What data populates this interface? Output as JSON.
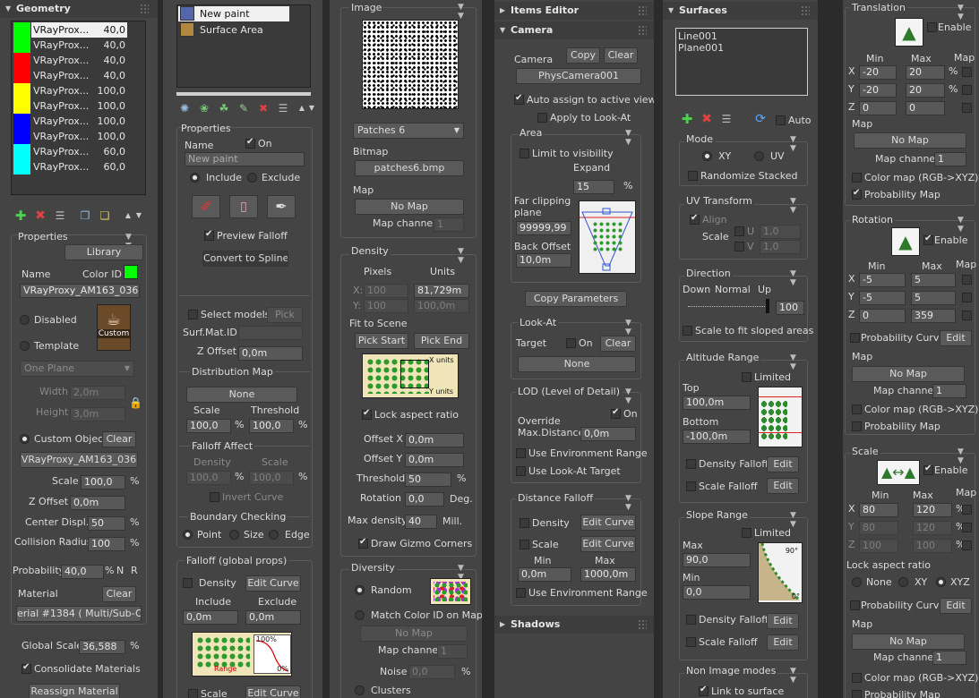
{
  "geometry": {
    "title": "Geometry",
    "items": [
      {
        "name": "VRayProx...",
        "value": "40,0",
        "color": "#00ff00"
      },
      {
        "name": "VRayProx...",
        "value": "40,0",
        "color": "#00ff00"
      },
      {
        "name": "VRayProx...",
        "value": "40,0",
        "color": "#ff0000"
      },
      {
        "name": "VRayProx...",
        "value": "40,0",
        "color": "#ff0000"
      },
      {
        "name": "VRayProx...",
        "value": "100,0",
        "color": "#ffff00"
      },
      {
        "name": "VRayProx...",
        "value": "100,0",
        "color": "#ffff00"
      },
      {
        "name": "VRayProx...",
        "value": "100,0",
        "color": "#0000ff"
      },
      {
        "name": "VRayProx...",
        "value": "100,0",
        "color": "#0000ff"
      },
      {
        "name": "VRayProx...",
        "value": "60,0",
        "color": "#00ffff"
      },
      {
        "name": "VRayProx...",
        "value": "60,0",
        "color": "#00ffff"
      }
    ],
    "properties": "Properties",
    "library": "Library",
    "name_label": "Name",
    "color_id_label": "Color ID",
    "name_value": "VRayProxy_AM163_036",
    "disabled": "Disabled",
    "template": "Template",
    "custom_thumb": "Custom",
    "one_plane": "One Plane",
    "width_label": "Width",
    "width_value": "2,0m",
    "height_label": "Height",
    "height_value": "3,0m",
    "custom_object": "Custom Object",
    "clear": "Clear",
    "custom_object_value": "VRayProxy_AM163_036",
    "scale_label": "Scale",
    "scale_value": "100,0",
    "pct": "%",
    "zoffset_label": "Z Offset",
    "zoffset_value": "0,0m",
    "center_label": "Center Displ.",
    "center_value": "50",
    "collision_label": "Collision Radius",
    "collision_value": "100",
    "probability_label": "Probability",
    "probability_value": "40,0",
    "n": "N",
    "r": "R",
    "material_label": "Material",
    "material_value": "erial #1384  ( Multi/Sub-Obje",
    "global_scale_label": "Global Scale",
    "global_scale_value": "36,588",
    "consolidate": "Consolidate Materials",
    "reassign": "Reassign Material"
  },
  "paint": {
    "items": [
      {
        "name": "New paint"
      },
      {
        "name": "Surface Area"
      }
    ],
    "properties": "Properties",
    "name_label": "Name",
    "on": "On",
    "name_value": "New paint",
    "include": "Include",
    "exclude": "Exclude",
    "preview_falloff": "Preview Falloff",
    "convert": "Convert to Spline",
    "select_models": "Select models",
    "pick": "Pick",
    "surf_mat": "Surf.Mat.ID",
    "zoffset_label": "Z Offset",
    "zoffset_value": "0,0m",
    "dist_map": "Distribution Map",
    "none": "None",
    "scale_label": "Scale",
    "threshold_label": "Threshold",
    "scale_value": "100,0",
    "threshold_value": "100,0",
    "pct": "%",
    "falloff_affect": "Falloff Affect",
    "density_label": "Density",
    "density_value": "100,0",
    "fa_scale_value": "100,0",
    "invert_curve": "Invert Curve",
    "boundary": "Boundary Checking",
    "point": "Point",
    "size": "Size",
    "edge": "Edge",
    "falloff_global": "Falloff (global props)",
    "edit_curve": "Edit Curve",
    "exclude_label": "Exclude",
    "include_value": "0,0m",
    "exclude_value": "0,0m",
    "range": "Range",
    "pct100": "100%",
    "pct0": "0%",
    "scale2": "Scale"
  },
  "image": {
    "title": "Image",
    "patches": "Patches 6",
    "bitmap_label": "Bitmap",
    "bitmap_value": "patches6.bmp",
    "map_label": "Map",
    "no_map": "No Map",
    "map_channel": "Map channel",
    "map_channel_value": "1",
    "density_title": "Density",
    "pixels": "Pixels",
    "units": "Units",
    "x": "X:",
    "y": "Y:",
    "px_x": "100",
    "px_y": "100",
    "u_x": "81,729m",
    "u_y": "100,0m",
    "fit_scene": "Fit to Scene",
    "pick_start": "Pick Start",
    "pick_end": "Pick End",
    "x_units": "X units",
    "y_units": "Y units",
    "lock_aspect": "Lock aspect ratio",
    "offset_x_label": "Offset X",
    "offset_x": "0,0m",
    "offset_y_label": "Offset Y",
    "offset_y": "0,0m",
    "threshold_label": "Threshold",
    "threshold": "50",
    "pct": "%",
    "rotation_label": "Rotation",
    "rotation": "0,0",
    "deg": "Deg.",
    "max_density_label": "Max density",
    "max_density": "40",
    "mill": "Mill.",
    "draw_gizmo": "Draw Gizmo Corners",
    "diversity": "Diversity",
    "random": "Random",
    "match_color": "Match Color ID on Map",
    "no_map2": "No Map",
    "map_channel2": "Map channel",
    "map_channel2_value": "1",
    "noise_label": "Noise",
    "noise": "0,0",
    "clusters": "Clusters"
  },
  "items": {
    "title": "Items Editor",
    "camera_title": "Camera",
    "camera_label": "Camera",
    "copy": "Copy",
    "clear": "Clear",
    "camera_value": "PhysCamera001",
    "auto_assign": "Auto assign to active view",
    "apply_look": "Apply to Look-At",
    "area": "Area",
    "limit_vis": "Limit to visibility",
    "expand": "Expand",
    "expand_value": "15",
    "pct": "%",
    "far_clip": "Far clipping",
    "plane": "plane",
    "far_value": "99999,99",
    "back_offset": "Back Offset",
    "back_value": "10,0m",
    "copy_params": "Copy Parameters",
    "look_at": "Look-At",
    "target": "Target",
    "on": "On",
    "none": "None",
    "lod": "LOD (Level of Detail)",
    "override": "Override",
    "max_dist": "Max.Distance",
    "max_dist_value": "0,0m",
    "use_env": "Use Environment Range",
    "use_look": "Use Look-At Target",
    "dist_falloff": "Distance Falloff",
    "density": "Density",
    "edit_curve": "Edit Curve",
    "scale": "Scale",
    "min": "Min",
    "max": "Max",
    "min_value": "0,0m",
    "max_value": "1000,0m",
    "use_env2": "Use Environment Range",
    "shadows": "Shadows"
  },
  "surfaces": {
    "title": "Surfaces",
    "list": [
      "Line001",
      "Plane001"
    ],
    "auto": "Auto",
    "mode": "Mode",
    "xy": "XY",
    "uv": "UV",
    "randomize": "Randomize Stacked",
    "uv_transform": "UV Transform",
    "align": "Align",
    "scale": "Scale",
    "u": "U",
    "v": "V",
    "u_value": "1,0",
    "v_value": "1,0",
    "direction": "Direction",
    "down": "Down",
    "normal": "Normal",
    "up": "Up",
    "dir_value": "100",
    "scale_fit": "Scale to fit sloped areas",
    "altitude": "Altitude Range",
    "limited": "Limited",
    "top": "Top",
    "top_value": "100,0m",
    "bottom": "Bottom",
    "bottom_value": "-100,0m",
    "density_falloff": "Density Falloff",
    "edit": "Edit",
    "scale_falloff": "Scale Falloff",
    "slope": "Slope Range",
    "limited2": "Limited",
    "max": "Max",
    "max_value": "90,0",
    "min": "Min",
    "min_value": "0,0",
    "deg90": "90°",
    "deg0": "0°",
    "density_falloff2": "Density Falloff",
    "scale_falloff2": "Scale Falloff",
    "non_image": "Non Image modes",
    "link_surface": "Link to surface"
  },
  "transform": {
    "translation": "Translation",
    "enable": "Enable",
    "min": "Min",
    "max": "Max",
    "map": "Map",
    "pct": "%",
    "t_x_min": "-20",
    "t_x_max": "20",
    "t_y_min": "-20",
    "t_y_max": "20",
    "t_z_min": "0",
    "t_z_max": "0",
    "no_map": "No Map",
    "map_channel": "Map channel",
    "map_channel_value": "1",
    "color_map": "Color map (RGB->XYZ)",
    "prob_map": "Probability Map",
    "rotation": "Rotation",
    "r_x_min": "-5",
    "r_x_max": "5",
    "r_y_min": "-5",
    "r_y_max": "5",
    "r_z_min": "0",
    "r_z_max": "359",
    "prob_curve": "Probability Curve",
    "edit": "Edit",
    "scale": "Scale",
    "s_x_min": "80",
    "s_x_max": "120",
    "s_y_min": "80",
    "s_y_max": "120",
    "s_z_min": "100",
    "s_z_max": "100",
    "lock_aspect": "Lock aspect ratio",
    "none": "None",
    "xy": "XY",
    "xyz": "XYZ",
    "x": "X",
    "y": "Y",
    "z": "Z"
  }
}
